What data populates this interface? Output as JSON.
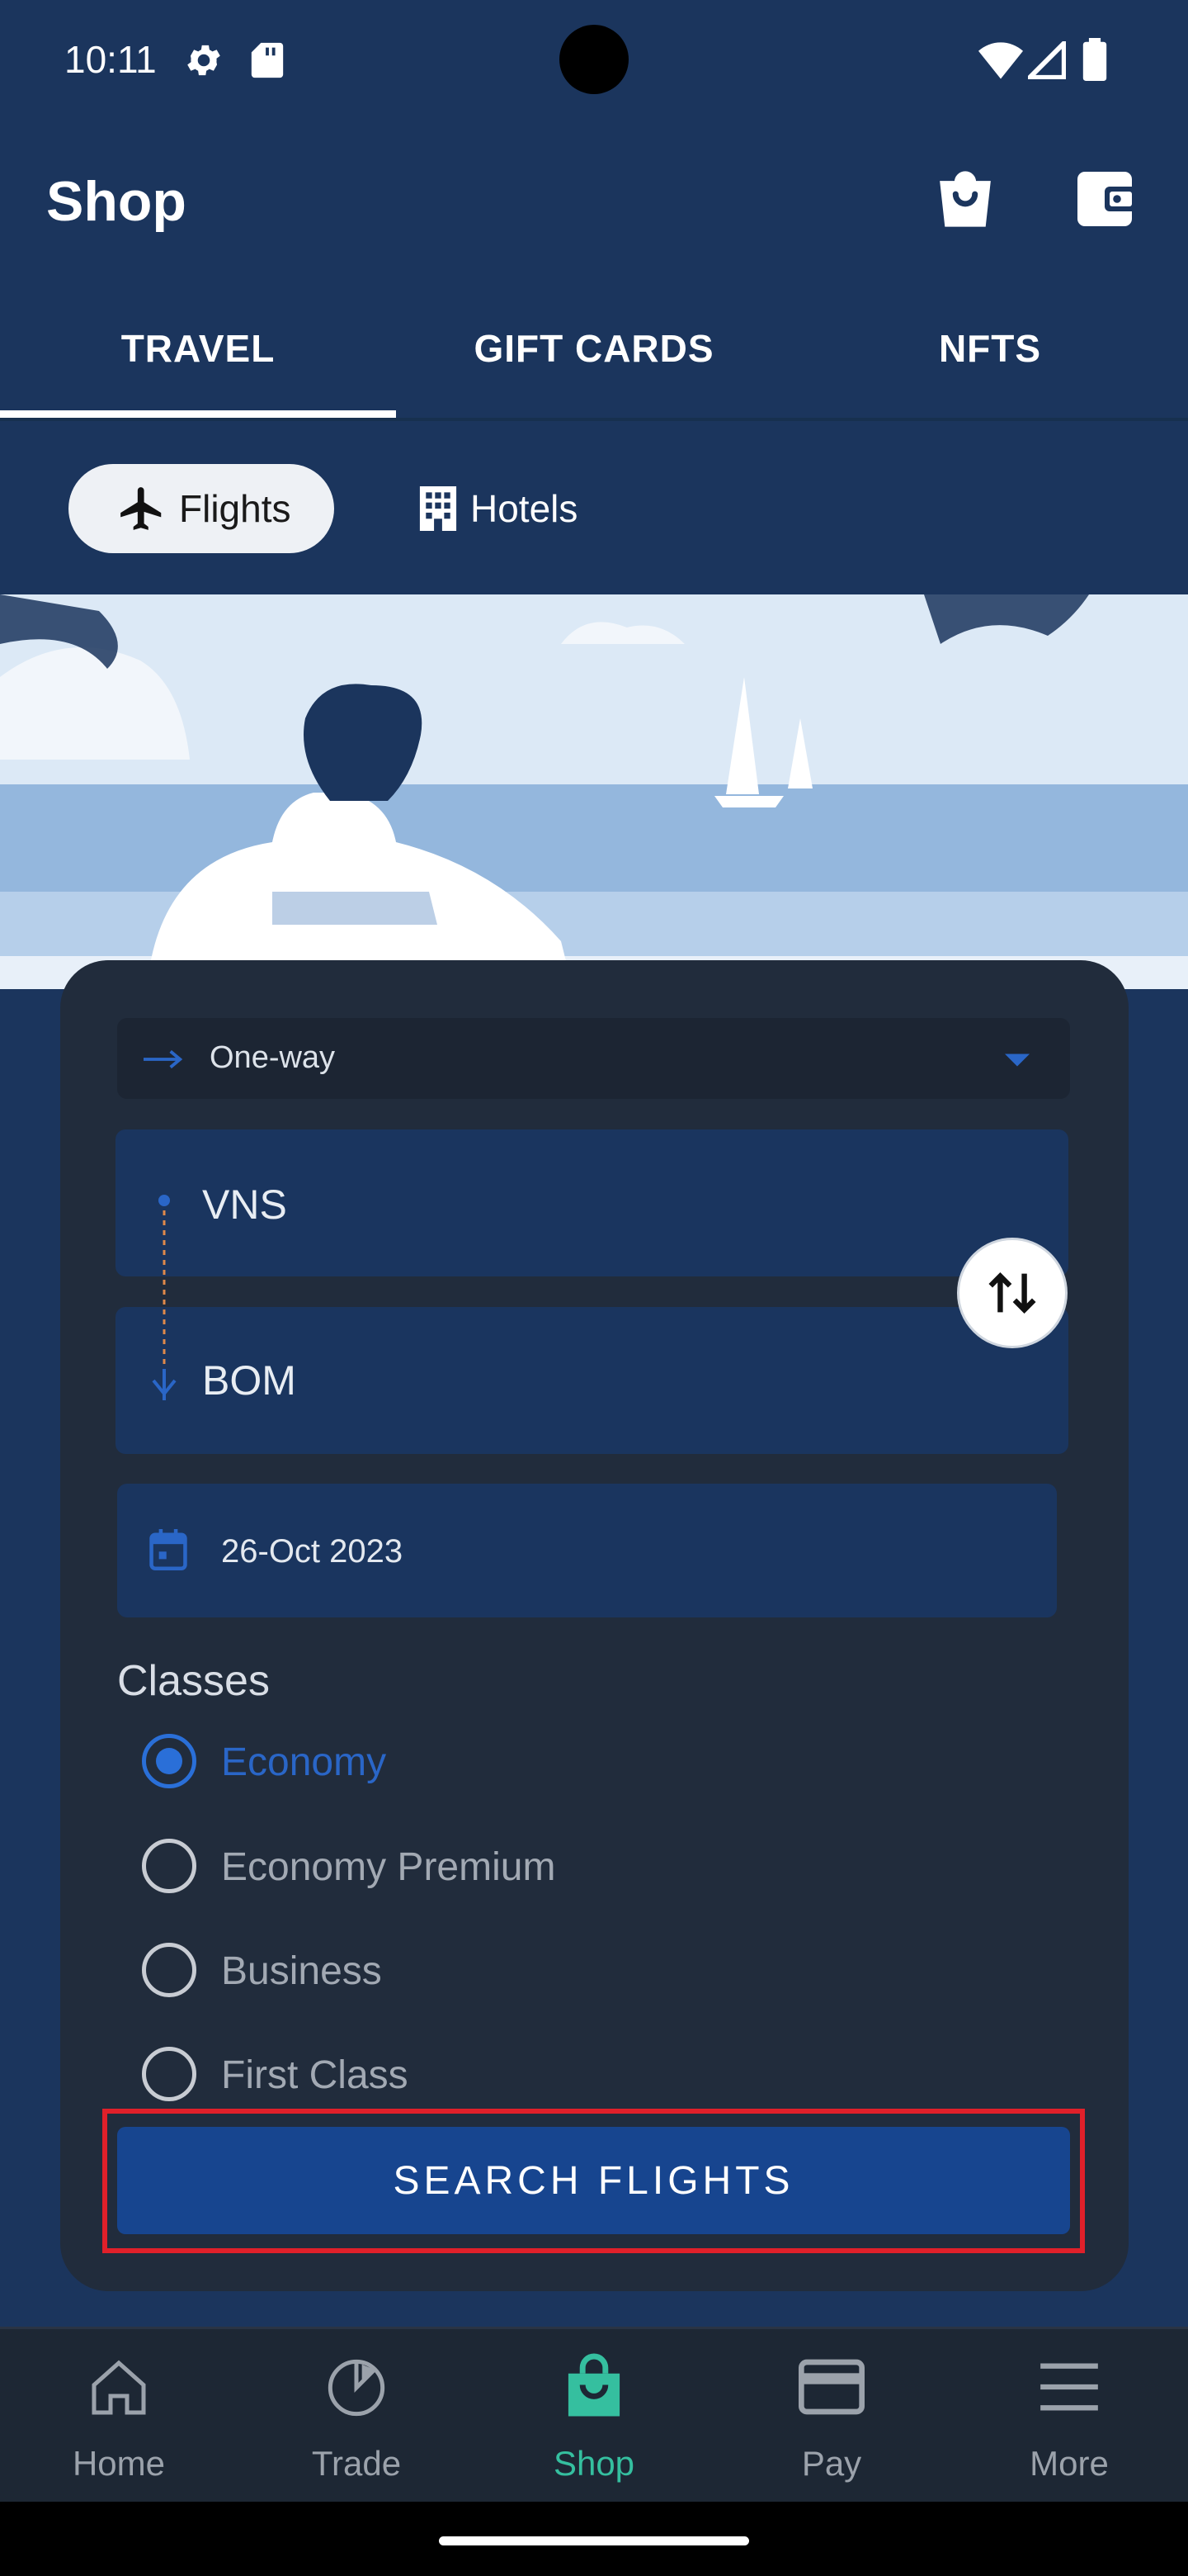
{
  "status_bar": {
    "time": "10:11"
  },
  "header": {
    "title": "Shop"
  },
  "tabs": [
    {
      "label": "TRAVEL",
      "active": true
    },
    {
      "label": "GIFT CARDS",
      "active": false
    },
    {
      "label": "NFTS",
      "active": false
    }
  ],
  "chips": {
    "flights": "Flights",
    "hotels": "Hotels",
    "selected": "Flights"
  },
  "form": {
    "trip_type": "One-way",
    "origin": "VNS",
    "destination": "BOM",
    "date": "26-Oct 2023",
    "classes_label": "Classes",
    "classes": [
      {
        "label": "Economy",
        "selected": true
      },
      {
        "label": "Economy Premium",
        "selected": false
      },
      {
        "label": "Business",
        "selected": false
      },
      {
        "label": "First Class",
        "selected": false
      }
    ],
    "search_button": "SEARCH FLIGHTS"
  },
  "bottom_nav": [
    {
      "label": "Home",
      "icon": "home-icon",
      "active": false
    },
    {
      "label": "Trade",
      "icon": "pie-chart-icon",
      "active": false
    },
    {
      "label": "Shop",
      "icon": "shopping-bag-icon",
      "active": true
    },
    {
      "label": "Pay",
      "icon": "credit-card-icon",
      "active": false
    },
    {
      "label": "More",
      "icon": "menu-icon",
      "active": false
    }
  ],
  "colors": {
    "background": "#1b355d",
    "card": "#212c3c",
    "accent_blue": "#2a66c7",
    "active_nav": "#35bf9f",
    "highlight": "#e0202a"
  }
}
